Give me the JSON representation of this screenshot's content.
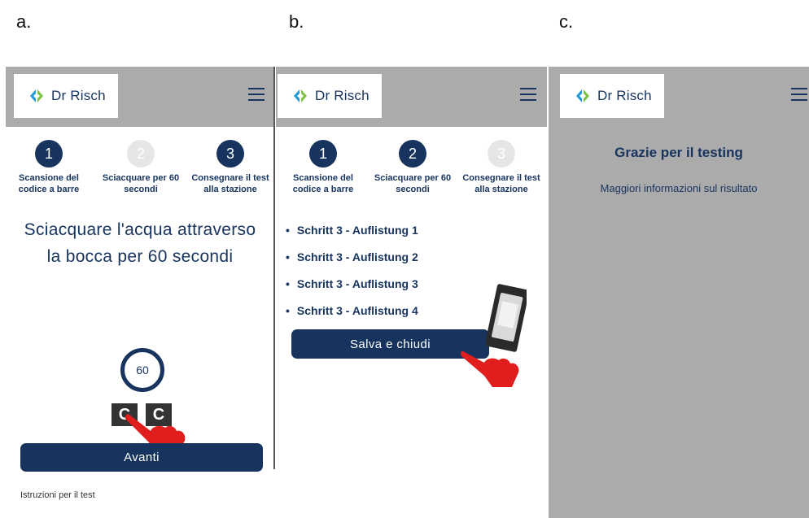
{
  "panels": [
    {
      "letter": "a.",
      "step": 2
    },
    {
      "letter": "b.",
      "step": 3
    },
    {
      "letter": "c.",
      "step": 4
    }
  ],
  "brand": {
    "name": "Dr Risch",
    "color": "#17345e",
    "logo_colors": [
      "#1f9ad6",
      "#7cc242"
    ]
  },
  "steps": [
    {
      "number": "1",
      "label_line1": "Scansione del",
      "label_line2": "codice a barre"
    },
    {
      "number": "2",
      "label_line1": "Sciacquare per 60",
      "label_line2": "secondi"
    },
    {
      "number": "3",
      "label_line1": "Consegnare il test",
      "label_line2": "alla stazione"
    }
  ],
  "screen_a": {
    "title_line1": "Sciacquare l'acqua attraverso",
    "title_line2": "la bocca per 60 secondi",
    "timer_value": "60",
    "ctrl_left": "C",
    "ctrl_right": "C",
    "next_button": "Avanti",
    "footer_link": "Istruzioni per il test",
    "step_states": [
      "active",
      "inactive",
      "active"
    ]
  },
  "screen_b": {
    "items": [
      "Schritt 3 - Auflistung 1",
      "Schritt 3 - Auflistung 2",
      "Schritt 3 - Auflistung 3",
      "Schritt 3 - Auflistung 4"
    ],
    "save_button": "Salva e chiudi",
    "step_states": [
      "active",
      "active",
      "inactive"
    ]
  },
  "screen_c": {
    "title": "Grazie per il testing",
    "subtitle": "Maggiori informazioni sul risultato"
  }
}
